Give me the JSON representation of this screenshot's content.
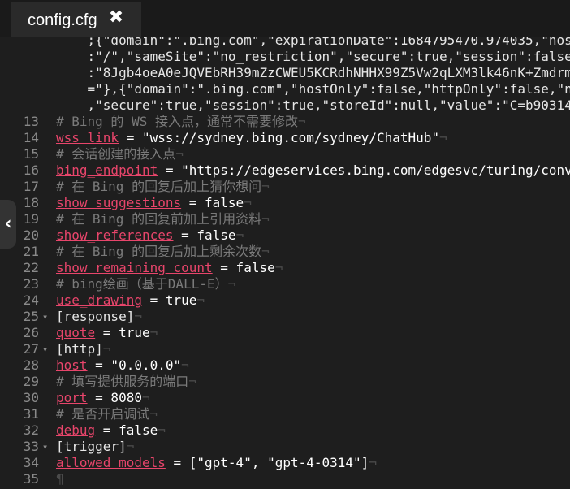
{
  "tab": {
    "title": "config.cfg",
    "close_glyph": "✖"
  },
  "sidebar_toggle": {
    "glyph": "‹"
  },
  "lines": [
    {
      "n": "",
      "fold": "",
      "parts": [
        {
          "cls": "str",
          "t": "    ;{\"domain\":\".bing.com\",\"expirationDate\":1684795470.974035,\"hos"
        }
      ]
    },
    {
      "n": "",
      "fold": "",
      "parts": [
        {
          "cls": "str",
          "t": "    :\"/\",\"sameSite\":\"no_restriction\",\"secure\":true,\"session\":false"
        }
      ]
    },
    {
      "n": "",
      "fold": "",
      "parts": [
        {
          "cls": "str",
          "t": "    :\"8Jgb4oeA0eJQVEbRH39mZzCWEU5KCRdhNHHX99Z5Vw2qLXM3lk46nK+Zmdrm"
        }
      ]
    },
    {
      "n": "",
      "fold": "",
      "parts": [
        {
          "cls": "str",
          "t": "    =\"},{\"domain\":\".bing.com\",\"hostOnly\":false,\"httpOnly\":false,\"n"
        }
      ]
    },
    {
      "n": "",
      "fold": "",
      "parts": [
        {
          "cls": "str",
          "t": "    ,\"secure\":true,\"session\":true,\"storeId\":null,\"value\":\"C=b90314"
        }
      ]
    },
    {
      "n": "13",
      "fold": "",
      "parts": [
        {
          "cls": "cmt",
          "t": "# Bing 的 WS 接入点，通常不需要修改"
        },
        {
          "cls": "eol",
          "t": "¬"
        }
      ]
    },
    {
      "n": "14",
      "fold": "",
      "parts": [
        {
          "cls": "key",
          "t": "wss_link"
        },
        {
          "cls": "val",
          "t": " = \"wss://sydney.bing.com/sydney/ChatHub\""
        },
        {
          "cls": "eol",
          "t": "¬"
        }
      ]
    },
    {
      "n": "15",
      "fold": "",
      "parts": [
        {
          "cls": "cmt",
          "t": "# 会话创建的接入点"
        },
        {
          "cls": "eol",
          "t": "¬"
        }
      ]
    },
    {
      "n": "16",
      "fold": "",
      "parts": [
        {
          "cls": "key",
          "t": "bing_endpoint"
        },
        {
          "cls": "val",
          "t": " = \"https://edgeservices.bing.com/edgesvc/turing/conv"
        }
      ]
    },
    {
      "n": "17",
      "fold": "",
      "parts": [
        {
          "cls": "cmt",
          "t": "# 在 Bing 的回复后加上猜你想问"
        },
        {
          "cls": "eol",
          "t": "¬"
        }
      ]
    },
    {
      "n": "18",
      "fold": "",
      "parts": [
        {
          "cls": "key",
          "t": "show_suggestions"
        },
        {
          "cls": "val",
          "t": " = false"
        },
        {
          "cls": "eol",
          "t": "¬"
        }
      ]
    },
    {
      "n": "19",
      "fold": "",
      "parts": [
        {
          "cls": "cmt",
          "t": "# 在 Bing 的回复前加上引用资料"
        },
        {
          "cls": "eol",
          "t": "¬"
        }
      ]
    },
    {
      "n": "20",
      "fold": "",
      "parts": [
        {
          "cls": "key",
          "t": "show_references"
        },
        {
          "cls": "val",
          "t": " = false"
        },
        {
          "cls": "eol",
          "t": "¬"
        }
      ]
    },
    {
      "n": "21",
      "fold": "",
      "parts": [
        {
          "cls": "cmt",
          "t": "# 在 Bing 的回复后加上剩余次数"
        },
        {
          "cls": "eol",
          "t": "¬"
        }
      ]
    },
    {
      "n": "22",
      "fold": "",
      "parts": [
        {
          "cls": "key",
          "t": "show_remaining_count"
        },
        {
          "cls": "val",
          "t": " = false"
        },
        {
          "cls": "eol",
          "t": "¬"
        }
      ]
    },
    {
      "n": "23",
      "fold": "",
      "parts": [
        {
          "cls": "cmt",
          "t": "# bing绘画（基于DALL-E）"
        },
        {
          "cls": "eol",
          "t": "¬"
        }
      ]
    },
    {
      "n": "24",
      "fold": "",
      "parts": [
        {
          "cls": "key",
          "t": "use_drawing"
        },
        {
          "cls": "val",
          "t": " = true"
        },
        {
          "cls": "eol",
          "t": "¬"
        }
      ]
    },
    {
      "n": "25",
      "fold": "▾",
      "parts": [
        {
          "cls": "sec",
          "t": "[response]"
        },
        {
          "cls": "eol",
          "t": "¬"
        }
      ]
    },
    {
      "n": "26",
      "fold": "",
      "parts": [
        {
          "cls": "key",
          "t": "quote"
        },
        {
          "cls": "val",
          "t": " = true"
        },
        {
          "cls": "eol",
          "t": "¬"
        }
      ]
    },
    {
      "n": "27",
      "fold": "▾",
      "parts": [
        {
          "cls": "sec",
          "t": "[http]"
        },
        {
          "cls": "eol",
          "t": "¬"
        }
      ]
    },
    {
      "n": "28",
      "fold": "",
      "parts": [
        {
          "cls": "key",
          "t": "host"
        },
        {
          "cls": "val",
          "t": " = \"0.0.0.0\""
        },
        {
          "cls": "eol",
          "t": "¬"
        }
      ]
    },
    {
      "n": "29",
      "fold": "",
      "parts": [
        {
          "cls": "cmt",
          "t": "# 填写提供服务的端口"
        },
        {
          "cls": "eol",
          "t": "¬"
        }
      ]
    },
    {
      "n": "30",
      "fold": "",
      "parts": [
        {
          "cls": "key",
          "t": "port"
        },
        {
          "cls": "val",
          "t": " = 8080"
        },
        {
          "cls": "eol",
          "t": "¬"
        }
      ]
    },
    {
      "n": "31",
      "fold": "",
      "parts": [
        {
          "cls": "cmt",
          "t": "# 是否开启调试"
        },
        {
          "cls": "eol",
          "t": "¬"
        }
      ]
    },
    {
      "n": "32",
      "fold": "",
      "parts": [
        {
          "cls": "key",
          "t": "debug"
        },
        {
          "cls": "val",
          "t": " = false"
        },
        {
          "cls": "eol",
          "t": "¬"
        }
      ]
    },
    {
      "n": "33",
      "fold": "▾",
      "parts": [
        {
          "cls": "sec",
          "t": "[trigger]"
        },
        {
          "cls": "eol",
          "t": "¬"
        }
      ]
    },
    {
      "n": "34",
      "fold": "",
      "parts": [
        {
          "cls": "key",
          "t": "allowed_models"
        },
        {
          "cls": "val",
          "t": " = [\"gpt-4\", \"gpt-4-0314\"]"
        },
        {
          "cls": "eol",
          "t": "¬"
        }
      ]
    },
    {
      "n": "35",
      "fold": "",
      "parts": [
        {
          "cls": "eol",
          "t": "¶"
        }
      ]
    }
  ]
}
